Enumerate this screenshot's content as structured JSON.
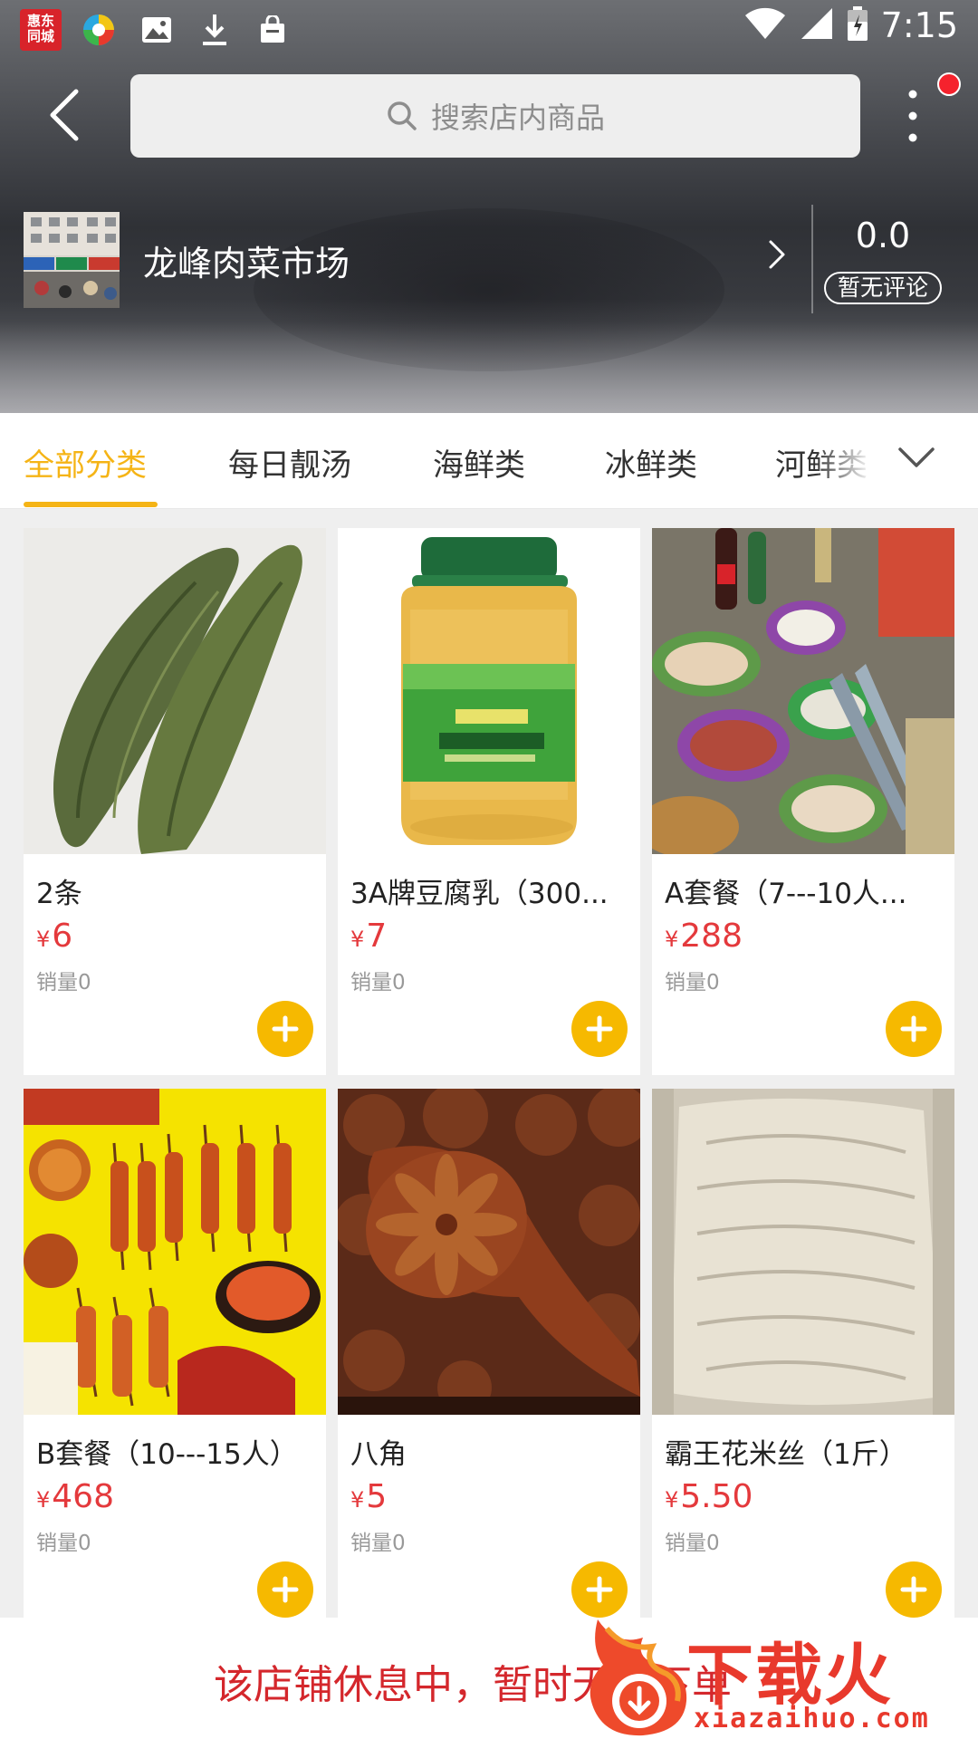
{
  "status_bar": {
    "app_badge": "惠东\n同城",
    "time": "7:15"
  },
  "header": {
    "search_placeholder": "搜索店内商品",
    "store_name": "龙峰肉菜市场",
    "rating": "0.0",
    "review_tag": "暂无评论"
  },
  "tabs": [
    {
      "label": "全部分类",
      "active": true
    },
    {
      "label": "每日靓汤",
      "active": false
    },
    {
      "label": "海鲜类",
      "active": false
    },
    {
      "label": "冰鲜类",
      "active": false
    },
    {
      "label": "河鲜类",
      "active": false
    }
  ],
  "products": [
    {
      "name": "2条",
      "price": "6",
      "sales": "销量0",
      "image": "loofah"
    },
    {
      "name": "3A牌豆腐乳（300...",
      "price": "7",
      "sales": "销量0",
      "image": "tofu-jar"
    },
    {
      "name": "A套餐（7---10人...",
      "price": "288",
      "sales": "销量0",
      "image": "hotpot-set"
    },
    {
      "name": "B套餐（10---15人）",
      "price": "468",
      "sales": "销量0",
      "image": "bbq-set"
    },
    {
      "name": "八角",
      "price": "5",
      "sales": "销量0",
      "image": "star-anise"
    },
    {
      "name": "霸王花米丝（1斤）",
      "price": "5.50",
      "sales": "销量0",
      "image": "rice-noodle"
    }
  ],
  "currency_symbol": "¥",
  "bottom": {
    "closed_message": "该店铺休息中，暂时无法下单"
  },
  "watermark": {
    "title": "下载火",
    "url": "xiazaihuo.com"
  },
  "colors": {
    "accent": "#f5b416",
    "price": "#e4393c",
    "add_button": "#f6b900",
    "closed_text": "#d4272c"
  }
}
